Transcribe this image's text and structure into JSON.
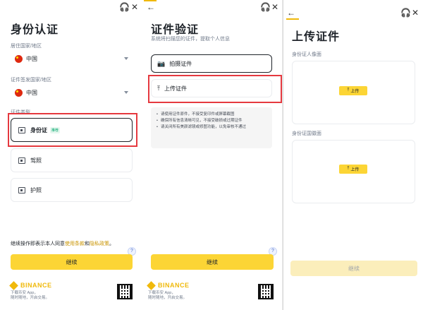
{
  "panel1": {
    "title": "身份认证",
    "residence_label": "居住国家/地区",
    "residence_value": "中国",
    "issuer_label": "证件签发国家/地区",
    "issuer_value": "中国",
    "doctype_label": "证件类型",
    "options": [
      {
        "label": "身份证",
        "badge": "推荐",
        "icon": "id-card-icon"
      },
      {
        "label": "驾照",
        "icon": "license-icon"
      },
      {
        "label": "护照",
        "icon": "passport-icon"
      }
    ],
    "consent_prefix": "继续操作即表示本人同意",
    "terms": "使用条款",
    "and": "和",
    "privacy": "隐私政策",
    "period": "。",
    "continue": "继续"
  },
  "panel2": {
    "title": "证件验证",
    "subtitle": "系统将扫描您的证件，提取个人信息",
    "photo_option": "拍摄证件",
    "upload_option": "上传证件",
    "tips": [
      "请使用证件原件，不接受复印件或屏幕截图",
      "确保所有信息清晰可见，不接受破损或过期证件",
      "请关闭所有美颜滤镜或修图功能，以免审核不通过"
    ],
    "continue": "继续"
  },
  "panel3": {
    "title": "上传证件",
    "front_label": "身份证人像面",
    "back_label": "身份证国徽面",
    "upload_btn": "上传",
    "continue": "继续"
  },
  "footer": {
    "brand": "BINANCE",
    "line1": "下载币安 App，",
    "line2": "随时随地，开启交易。"
  },
  "icons": {
    "headset": "🎧",
    "close": "✕",
    "back": "←",
    "camera": "📷",
    "upload": "⤒",
    "help": "?"
  },
  "colors": {
    "accent": "#fcd535",
    "highlight": "#e5393f"
  }
}
